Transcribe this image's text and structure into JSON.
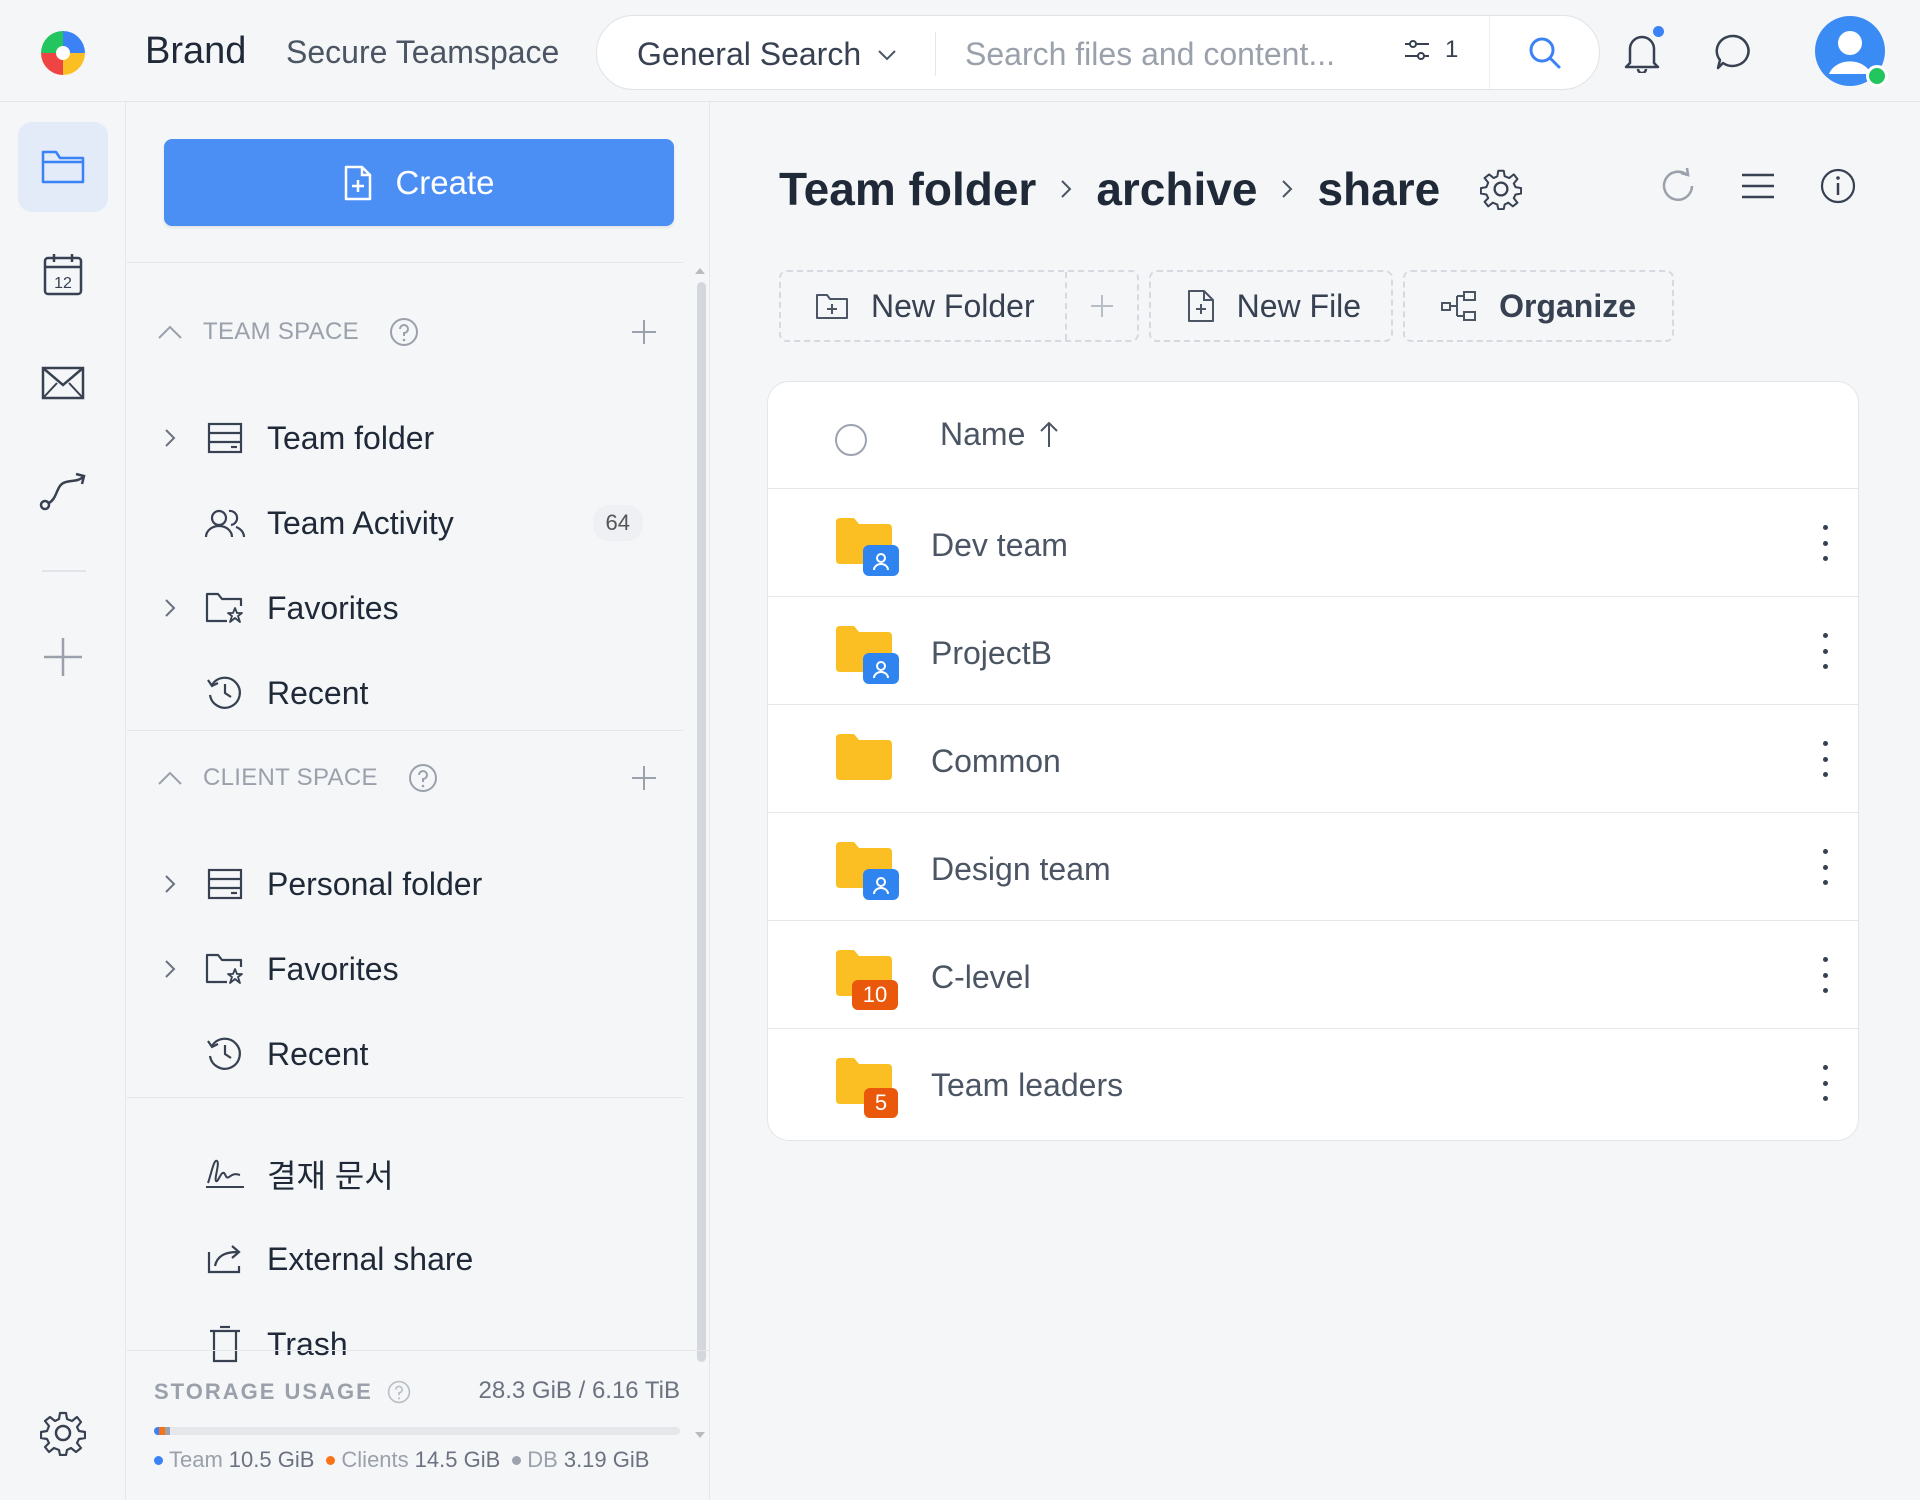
{
  "header": {
    "brand": "Brand",
    "workspace": "Secure Teamspace",
    "search": {
      "scope": "General Search",
      "placeholder": "Search files and content...",
      "filter_count": "1"
    }
  },
  "sidebar": {
    "create_label": "Create",
    "team_space": {
      "title": "TEAM SPACE",
      "items": [
        {
          "label": "Team folder"
        },
        {
          "label": "Team Activity",
          "badge": "64"
        },
        {
          "label": "Favorites"
        },
        {
          "label": "Recent"
        }
      ]
    },
    "client_space": {
      "title": "CLIENT SPACE",
      "items": [
        {
          "label": "Personal folder"
        },
        {
          "label": "Favorites"
        },
        {
          "label": "Recent"
        }
      ]
    },
    "extra_items": [
      {
        "label": "결재 문서"
      },
      {
        "label": "External share"
      },
      {
        "label": "Trash"
      }
    ],
    "storage": {
      "title": "STORAGE USAGE",
      "total": "28.3 GiB / 6.16 TiB",
      "legend": [
        {
          "label": "Team",
          "value": "10.5 GiB",
          "color": "#3b82f6",
          "fraction": 0.0017
        },
        {
          "label": "Clients",
          "value": "14.5 GiB",
          "color": "#f97316",
          "fraction": 0.0023
        },
        {
          "label": "DB",
          "value": "3.19 GiB",
          "color": "#9ca3af",
          "fraction": 0.0005
        }
      ]
    }
  },
  "main": {
    "breadcrumb": [
      "Team folder",
      "archive",
      "share"
    ],
    "actions": {
      "new_folder": "New Folder",
      "new_file": "New File",
      "organize": "Organize"
    },
    "table": {
      "column_name": "Name",
      "rows": [
        {
          "name": "Dev team",
          "badge_type": "user"
        },
        {
          "name": "ProjectB",
          "badge_type": "user"
        },
        {
          "name": "Common",
          "badge_type": "none"
        },
        {
          "name": "Design team",
          "badge_type": "user"
        },
        {
          "name": "C-level",
          "badge_type": "count",
          "count": "10"
        },
        {
          "name": "Team leaders",
          "badge_type": "count",
          "count": "5"
        }
      ]
    }
  },
  "colors": {
    "accent": "#4b8ef4",
    "folder": "#fbbf24",
    "count_badge": "#ea580c",
    "user_badge": "#2f84f0"
  }
}
